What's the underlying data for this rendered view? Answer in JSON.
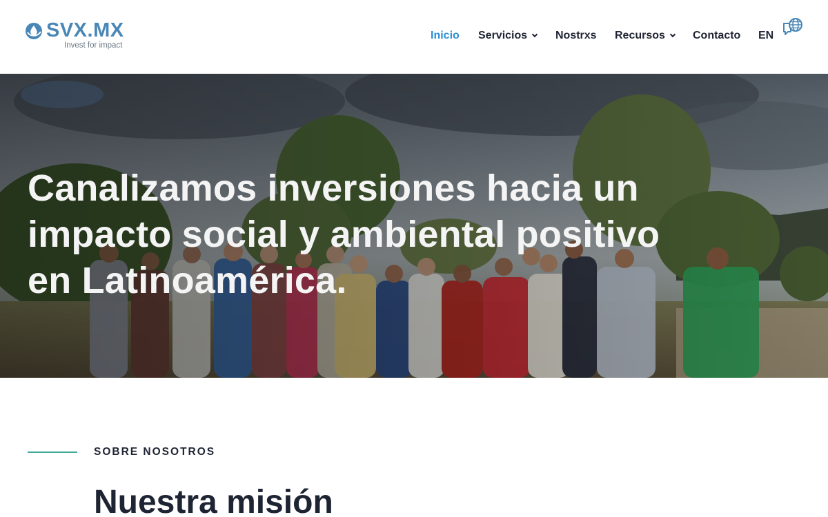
{
  "brand": {
    "name": "SVX.MX",
    "tagline": "Invest for impact",
    "color": "#4a87b6"
  },
  "nav": {
    "items": [
      {
        "label": "Inicio",
        "active": true,
        "dropdown": false
      },
      {
        "label": "Servicios",
        "active": false,
        "dropdown": true
      },
      {
        "label": "Nostrxs",
        "active": false,
        "dropdown": false
      },
      {
        "label": "Recursos",
        "active": false,
        "dropdown": true
      },
      {
        "label": "Contacto",
        "active": false,
        "dropdown": false
      },
      {
        "label": "EN",
        "active": false,
        "dropdown": false
      }
    ],
    "language_icon": "globe-chat-icon",
    "active_color": "#2b8fd3"
  },
  "hero": {
    "title": "Canalizamos inversiones hacia un impacto social y ambiental positivo en Latinoamérica."
  },
  "about": {
    "kicker": "SOBRE NOSOTROS",
    "title": "Nuestra misión",
    "accent_color": "#3fa89a"
  }
}
